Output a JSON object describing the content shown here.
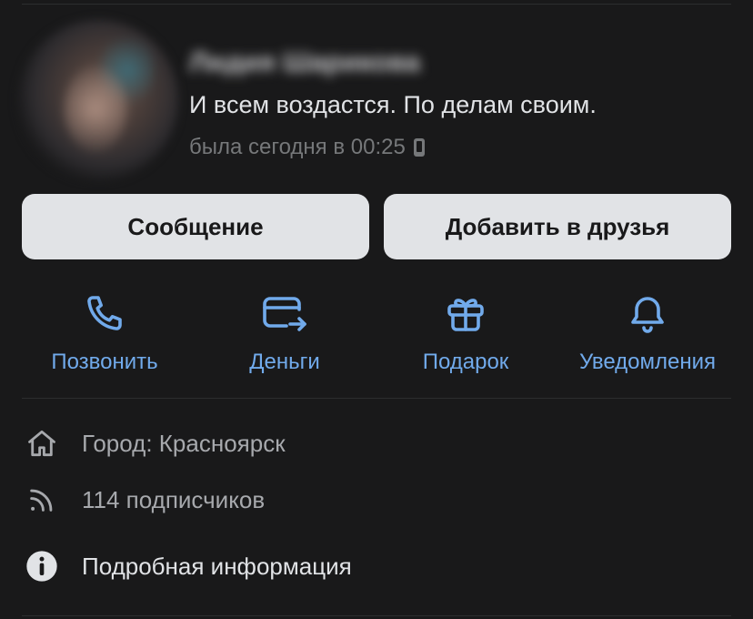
{
  "profile": {
    "name": "Лидия Шарикова",
    "status": "И всем воздастся. По делам своим.",
    "last_seen": "была сегодня в 00:25"
  },
  "buttons": {
    "message": "Сообщение",
    "add_friend": "Добавить в друзья"
  },
  "actions": [
    {
      "label": "Позвонить",
      "icon": "phone-icon"
    },
    {
      "label": "Деньги",
      "icon": "money-transfer-icon"
    },
    {
      "label": "Подарок",
      "icon": "gift-icon"
    },
    {
      "label": "Уведомления",
      "icon": "bell-icon"
    }
  ],
  "info": {
    "city": "Город: Красноярск",
    "followers": "114 подписчиков",
    "details": "Подробная информация"
  },
  "colors": {
    "background": "#19191a",
    "accent": "#71aaeb",
    "button_bg": "#e1e3e6",
    "muted_text": "#76787a"
  }
}
